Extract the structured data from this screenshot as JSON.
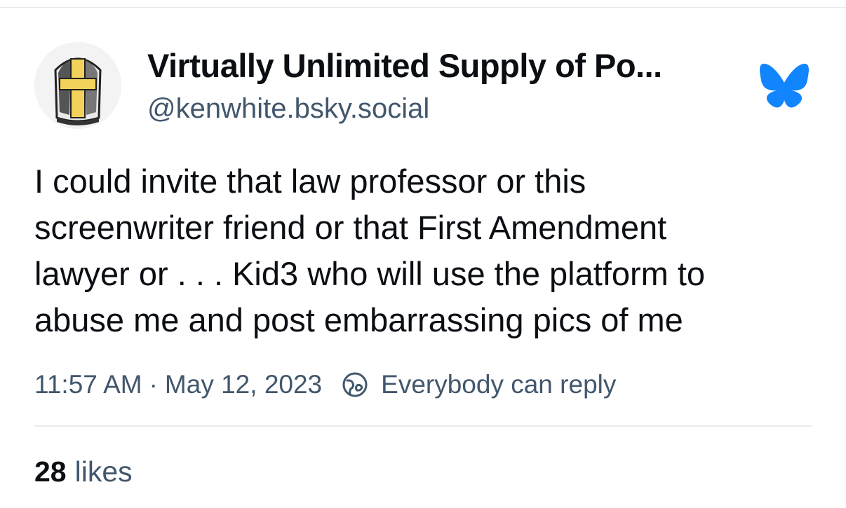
{
  "post": {
    "author": {
      "display_name": "Virtually Unlimited Supply of Po...",
      "handle": "@kenwhite.bsky.social",
      "avatar_icon": "mitre-cross-avatar"
    },
    "platform_icon": "bluesky-butterfly-icon",
    "text_lines": [
      "I could invite that law professor or this",
      "screenwriter friend or that First Amendment",
      "lawyer or . . . Kid3 who will use the platform to",
      "abuse me and post embarrassing pics of me"
    ],
    "time": "11:57 AM",
    "separator": "·",
    "date": "May 12, 2023",
    "reply_setting": "Everybody can reply",
    "likes": {
      "count": "28",
      "label": "likes"
    }
  },
  "colors": {
    "text": "#0b0f14",
    "muted": "#42576c",
    "brand": "#1185fe",
    "divider": "#e9ebee"
  }
}
